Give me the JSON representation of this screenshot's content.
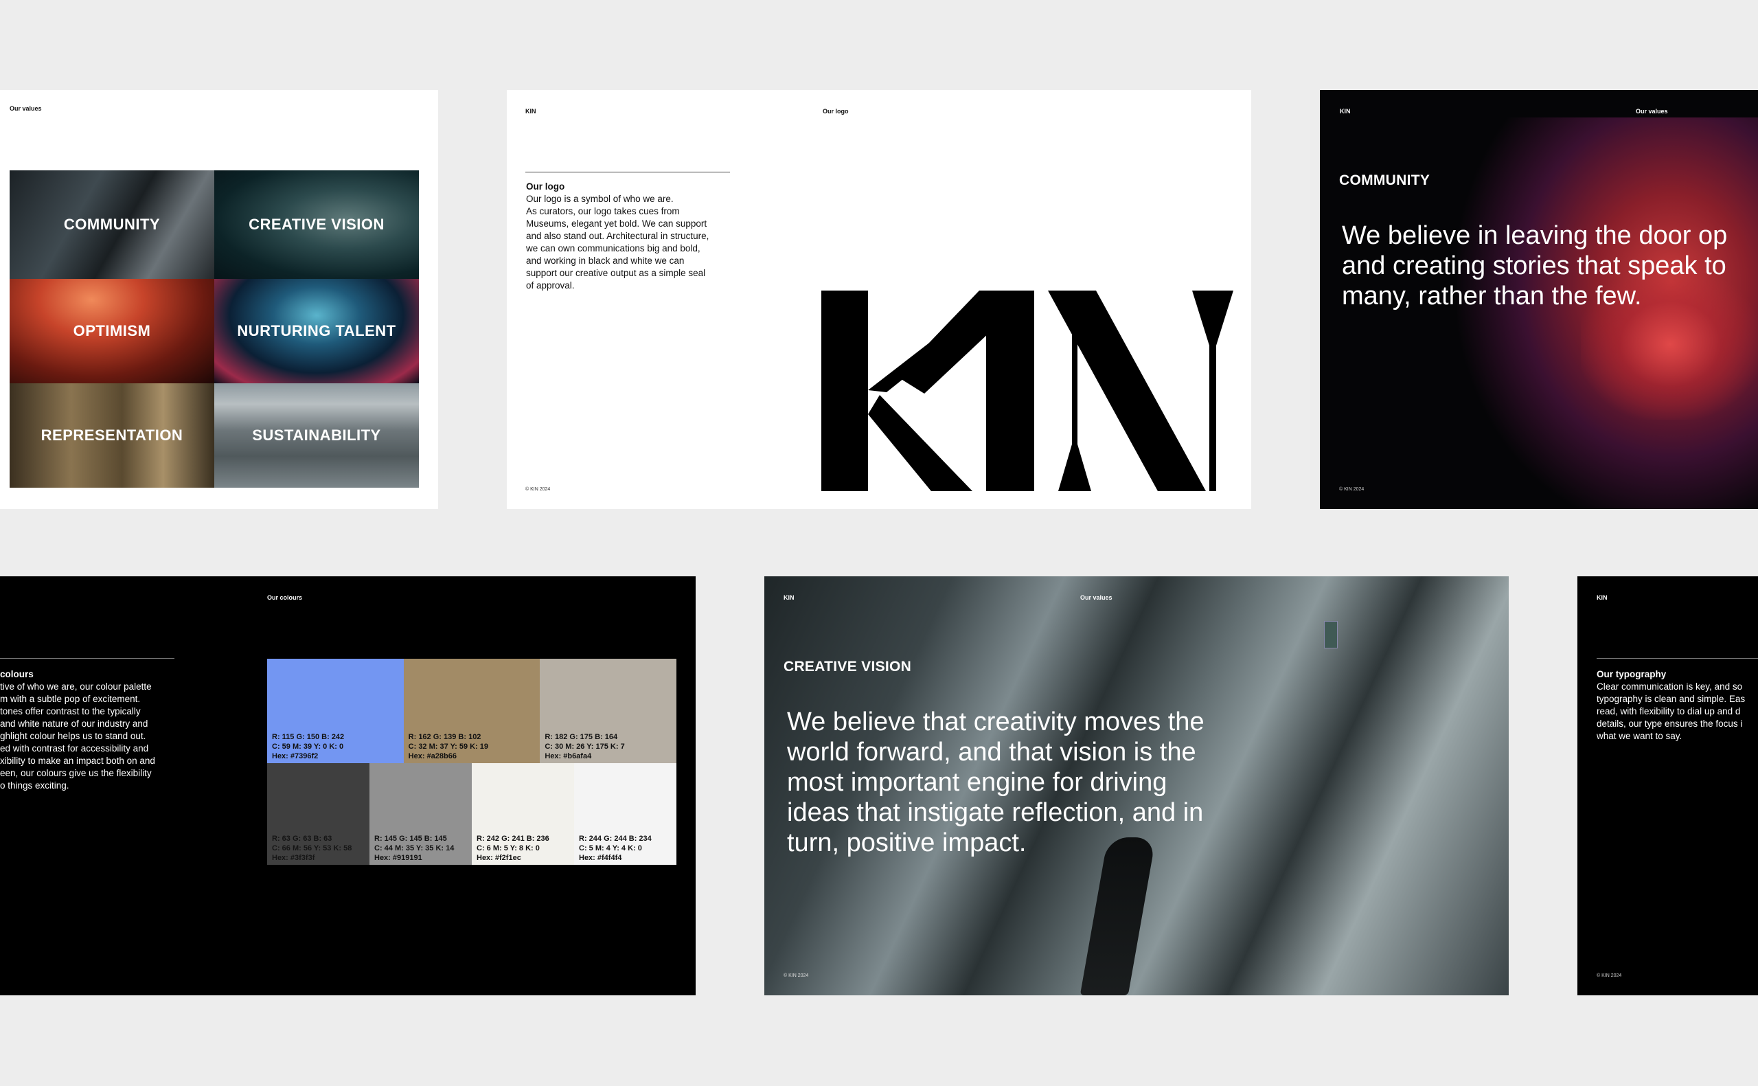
{
  "slide_values": {
    "label": "Our values",
    "tiles": [
      "COMMUNITY",
      "CREATIVE VISION",
      "OPTIMISM",
      "NURTURING TALENT",
      "REPRESENTATION",
      "SUSTAINABILITY"
    ]
  },
  "slide_logo": {
    "brand": "KIN",
    "label": "Our logo",
    "heading": "Our logo",
    "body": [
      "Our logo is a symbol of who we are.",
      "As curators, our logo takes cues from",
      "Museums, elegant yet bold. We can support",
      "and also stand out. Architectural in structure,",
      "we can own communications big and bold,",
      "and working in black and white we can",
      "support our creative output as a simple seal",
      "of approval."
    ],
    "footer": "© KIN 2024",
    "logo_text": "KIN"
  },
  "slide_community": {
    "brand": "KIN",
    "label": "Our values",
    "heading": "COMMUNITY",
    "statement": [
      "We believe in leaving the door op",
      "and creating stories that speak to",
      "many, rather than the few."
    ],
    "footer": "© KIN 2024"
  },
  "slide_colours": {
    "label": "Our colours",
    "heading": "colours",
    "body": [
      "tive of who we are, our colour palette",
      "m with a subtle pop of excitement.",
      "tones offer contrast to the typically",
      "and white nature of our industry and",
      "ghlight colour helps us to stand out.",
      "ed with contrast for accessibility and",
      "xibility to make an impact both on and",
      "een, our colours give us the flexibility",
      "o things exciting."
    ],
    "swatches_top": [
      {
        "rgb": "R: 115 G: 150 B: 242",
        "cmyk": "C: 59 M: 39 Y: 0 K: 0",
        "hex": "Hex: #7396f2",
        "color": "#7396f2",
        "text": "#111111"
      },
      {
        "rgb": "R: 162 G: 139 B: 102",
        "cmyk": "C: 32 M: 37 Y: 59 K: 19",
        "hex": "Hex: #a28b66",
        "color": "#a28b66",
        "text": "#111111"
      },
      {
        "rgb": "R: 182 G: 175 B: 164",
        "cmyk": "C: 30 M: 26 Y: 175 K: 7",
        "hex": "Hex: #b6afa4",
        "color": "#b6afa4",
        "text": "#111111"
      }
    ],
    "swatches_bottom": [
      {
        "rgb": "R: 63 G: 63 B: 63",
        "cmyk": "C: 66 M: 56 Y: 53 K: 58",
        "hex": "Hex: #3f3f3f",
        "color": "#3f3f3f",
        "text": "#151515"
      },
      {
        "rgb": "R: 145 G: 145 B: 145",
        "cmyk": "C: 44 M: 35 Y: 35 K: 14",
        "hex": "Hex: #919191",
        "color": "#919191",
        "text": "#111111"
      },
      {
        "rgb": "R: 242 G: 241 B: 236",
        "cmyk": "C: 6 M: 5 Y: 8 K: 0",
        "hex": "Hex: #f2f1ec",
        "color": "#f2f1ec",
        "text": "#111111"
      },
      {
        "rgb": "R: 244 G: 244 B: 234",
        "cmyk": "C: 5 M: 4 Y: 4 K: 0",
        "hex": "Hex: #f4f4f4",
        "color": "#f4f4f4",
        "text": "#111111"
      }
    ]
  },
  "slide_vision": {
    "brand": "KIN",
    "label": "Our values",
    "heading": "CREATIVE VISION",
    "statement": [
      "We believe that creativity moves the",
      "world forward, and that vision is the",
      "most important engine for driving",
      "ideas that instigate reflection, and in",
      "turn, positive impact."
    ],
    "footer": "© KIN 2024"
  },
  "slide_typography": {
    "brand": "KIN",
    "heading": "Our typography",
    "body": [
      "Clear communication is key, and so",
      "typography is clean and simple. Eas",
      "read, with flexibility to dial up and d",
      "details, our type ensures the focus i",
      "what we want to say."
    ],
    "footer": "© KIN 2024"
  }
}
